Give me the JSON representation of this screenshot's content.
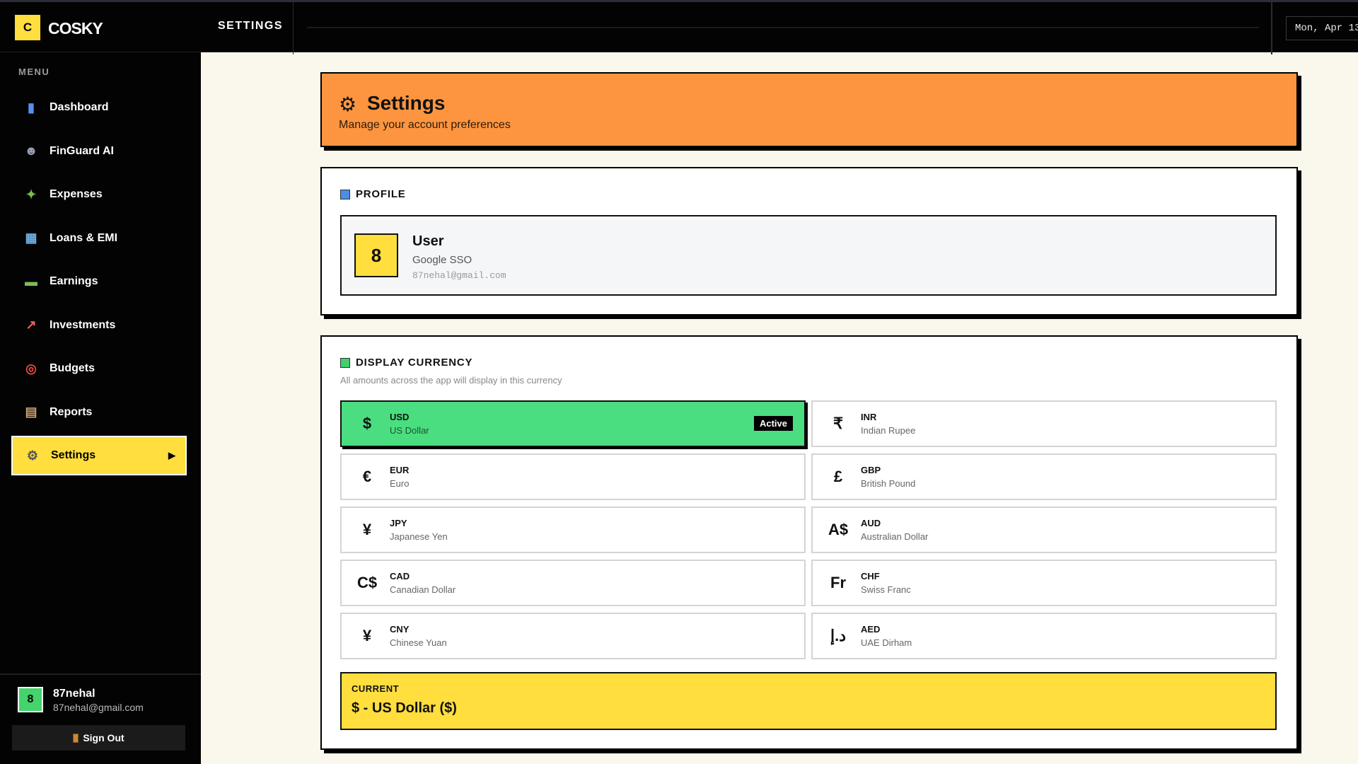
{
  "topbar": {
    "logo_letter": "C",
    "brand": "COSKY",
    "section_title": "SETTINGS",
    "date": "Mon, Apr 13"
  },
  "sidebar": {
    "menu_label": "MENU",
    "items": [
      {
        "label": "Dashboard",
        "icon": "bar-chart-icon",
        "color": "#5b8def"
      },
      {
        "label": "FinGuard AI",
        "icon": "robot-icon",
        "color": "#9aa4b2"
      },
      {
        "label": "Expenses",
        "icon": "money-wings-icon",
        "color": "#7bbf4c"
      },
      {
        "label": "Loans & EMI",
        "icon": "bank-icon",
        "color": "#6fb2e8"
      },
      {
        "label": "Earnings",
        "icon": "cash-icon",
        "color": "#7cbd5b"
      },
      {
        "label": "Investments",
        "icon": "trend-up-icon",
        "color": "#e86060"
      },
      {
        "label": "Budgets",
        "icon": "target-icon",
        "color": "#e8473f"
      },
      {
        "label": "Reports",
        "icon": "clipboard-icon",
        "color": "#c9a06a"
      },
      {
        "label": "Settings",
        "icon": "gear-icon",
        "color": "#555555",
        "active": true
      }
    ],
    "user": {
      "avatar": "8",
      "name": "87nehal",
      "email": "87nehal@gmail.com"
    },
    "sign_out": "Sign Out"
  },
  "header": {
    "title": "Settings",
    "subtitle": "Manage your account preferences",
    "icon": "gear-icon",
    "color": "#fd9540"
  },
  "profile": {
    "section_title": "PROFILE",
    "avatar": "8",
    "name": "User",
    "provider": "Google SSO",
    "email": "87nehal@gmail.com"
  },
  "currency": {
    "section_title": "DISPLAY CURRENCY",
    "subtitle": "All amounts across the app will display in this currency",
    "active_badge": "Active",
    "options": [
      {
        "symbol": "$",
        "code": "USD",
        "name": "US Dollar",
        "active": true
      },
      {
        "symbol": "₹",
        "code": "INR",
        "name": "Indian Rupee"
      },
      {
        "symbol": "€",
        "code": "EUR",
        "name": "Euro"
      },
      {
        "symbol": "£",
        "code": "GBP",
        "name": "British Pound"
      },
      {
        "symbol": "¥",
        "code": "JPY",
        "name": "Japanese Yen"
      },
      {
        "symbol": "A$",
        "code": "AUD",
        "name": "Australian Dollar"
      },
      {
        "symbol": "C$",
        "code": "CAD",
        "name": "Canadian Dollar"
      },
      {
        "symbol": "Fr",
        "code": "CHF",
        "name": "Swiss Franc"
      },
      {
        "symbol": "¥",
        "code": "CNY",
        "name": "Chinese Yuan"
      },
      {
        "symbol": "د.إ",
        "code": "AED",
        "name": "UAE Dirham"
      }
    ],
    "current_label": "CURRENT",
    "current_value": "$ - US Dollar ($)"
  }
}
